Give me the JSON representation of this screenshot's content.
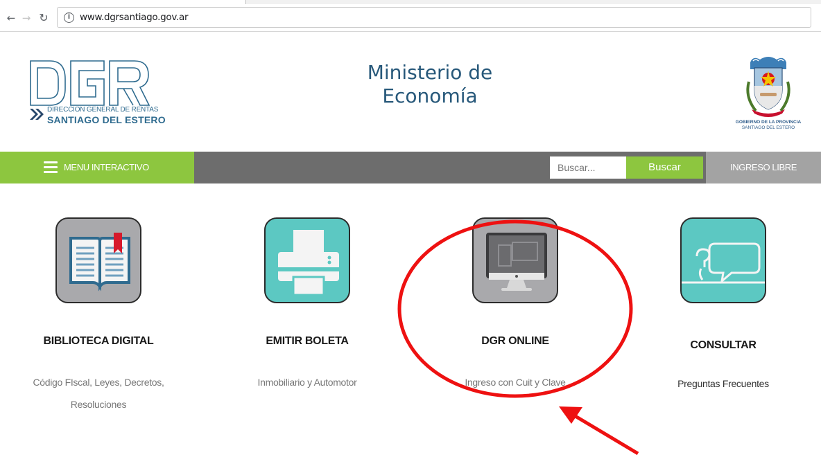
{
  "browser": {
    "url": "www.dgrsantiago.gov.ar"
  },
  "header": {
    "logo_line1": "DIRECCION GENERAL DE RENTAS",
    "logo_line2": "SANTIAGO DEL ESTERO",
    "ministry_line1": "Ministerio de",
    "ministry_line2": "Economía",
    "crest_line1": "GOBIERNO DE LA PROVINCIA",
    "crest_line2": "SANTIAGO DEL ESTERO"
  },
  "navbar": {
    "menu_label": "MENU INTERACTIVO",
    "search_placeholder": "Buscar...",
    "search_button": "Buscar",
    "ingreso_label": "INGRESO LIBRE",
    "colors": {
      "green": "#8dc63f",
      "gray": "#6d6d6d",
      "light_gray": "#a3a3a3"
    }
  },
  "cards": [
    {
      "icon": "book-icon",
      "title": "BIBLIOTECA DIGITAL",
      "subtitle_line1": "Código FIscal, Leyes, Decretos,",
      "subtitle_line2": "Resoluciones"
    },
    {
      "icon": "printer-icon",
      "title": "EMITIR BOLETA",
      "subtitle_line1": "Inmobiliario y Automotor"
    },
    {
      "icon": "computer-icon",
      "title": "DGR ONLINE",
      "subtitle_line1": "Ingreso con Cuit y Clave"
    },
    {
      "icon": "chat-question-icon",
      "title": "CONSULTAR",
      "subtitle_line1": "Preguntas Frecuentes"
    }
  ],
  "annotation": {
    "color": "#ee1111",
    "target": "DGR ONLINE"
  }
}
